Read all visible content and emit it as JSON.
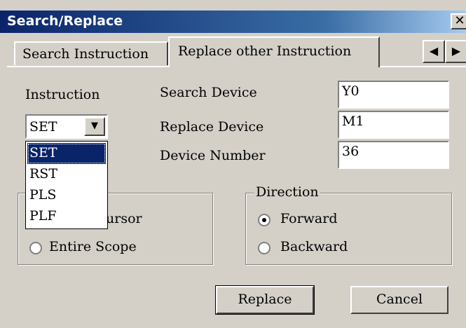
{
  "window": {
    "title": "Search/Replace",
    "close_label": "✕"
  },
  "tabs": [
    {
      "label": "Search Instruction"
    },
    {
      "label": "Replace other Instruction"
    }
  ],
  "tab_scroll": {
    "left": "◀",
    "right": "▶"
  },
  "instruction": {
    "label": "Instruction",
    "value": "SET",
    "arrow": "▼",
    "options": [
      "SET",
      "RST",
      "PLS",
      "PLF"
    ],
    "selected_index": 0
  },
  "fields": {
    "search_device": {
      "label": "Search Device",
      "value": "Y0"
    },
    "replace_device": {
      "label": "Replace Device",
      "value": "M1"
    },
    "device_number": {
      "label": "Device Number",
      "value": "36"
    }
  },
  "scope": {
    "options": [
      "ursor",
      "Entire Scope"
    ]
  },
  "direction": {
    "legend": "Direction",
    "options": [
      "Forward",
      "Backward"
    ],
    "selected": "Forward"
  },
  "buttons": {
    "replace": "Replace",
    "cancel": "Cancel"
  }
}
